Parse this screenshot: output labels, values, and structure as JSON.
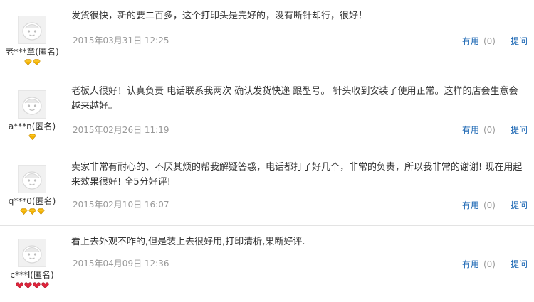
{
  "reviews": [
    {
      "user": "老***章(匿名)",
      "level_icon": "gold-diamond",
      "level_count": 2,
      "content": "发货很快，新的要二百多，这个打印头是完好的，没有断针却行，很好！",
      "date": "2015年03月31日 12:25",
      "useful_label": "有用",
      "useful_count": "(0)",
      "ask_label": "提问"
    },
    {
      "user": "a***n(匿名)",
      "level_icon": "gold-diamond",
      "level_count": 1,
      "content": "老板人很好！认真负责 电话联系我两次 确认发货快递 跟型号。 针头收到安装了使用正常。这样的店会生意会越来越好。",
      "date": "2015年02月26日 11:19",
      "useful_label": "有用",
      "useful_count": "(0)",
      "ask_label": "提问"
    },
    {
      "user": "q***0(匿名)",
      "level_icon": "gold-diamond",
      "level_count": 3,
      "content": "卖家非常有耐心的、不厌其烦的帮我解疑答惑，电话都打了好几个，非常的负责，所以我非常的谢谢! 现在用起来效果很好! 全5分好评!",
      "date": "2015年02月10日 16:07",
      "useful_label": "有用",
      "useful_count": "(0)",
      "ask_label": "提问"
    },
    {
      "user": "c***l(匿名)",
      "level_icon": "red-heart",
      "level_count": 4,
      "content": "看上去外观不咋的,但是装上去很好用,打印清析,果断好评.",
      "date": "2015年04月09日 12:36",
      "useful_label": "有用",
      "useful_count": "(0)",
      "ask_label": "提问"
    }
  ],
  "colors": {
    "link": "#1a66b3",
    "date": "#999999",
    "text": "#333333",
    "divider": "#e3e3e3",
    "gold": "#f5b400",
    "red": "#e0243b"
  }
}
